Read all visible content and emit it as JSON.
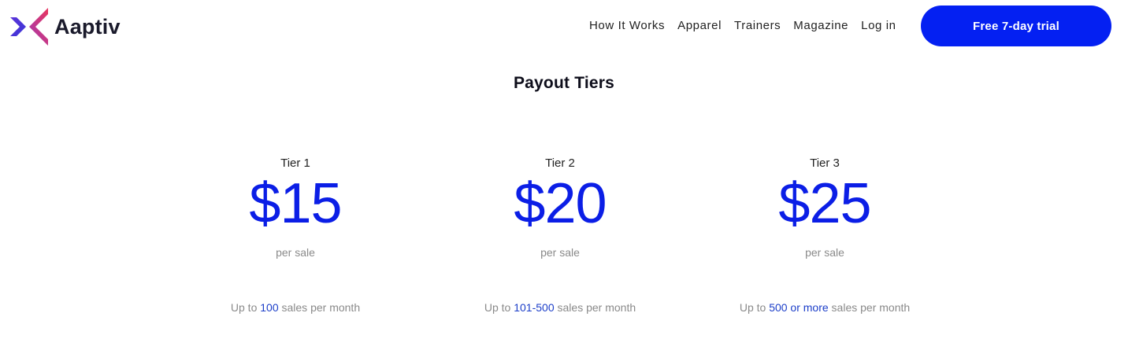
{
  "brand": {
    "name": "Aaptiv",
    "colors": {
      "mark_left": "#3b35d6",
      "mark_right": "#e8355f",
      "accent": "#0420f2",
      "price": "#0b1ee6"
    }
  },
  "nav": {
    "items": [
      {
        "label": "How It Works"
      },
      {
        "label": "Apparel"
      },
      {
        "label": "Trainers"
      },
      {
        "label": "Magazine"
      },
      {
        "label": "Log in"
      }
    ],
    "cta_label": "Free 7-day trial"
  },
  "section": {
    "title": "Payout Tiers"
  },
  "tiers": [
    {
      "label": "Tier 1",
      "price": "$15",
      "unit": "per sale",
      "desc_prefix": "Up to ",
      "desc_highlight": "100",
      "desc_suffix": " sales per month"
    },
    {
      "label": "Tier 2",
      "price": "$20",
      "unit": "per sale",
      "desc_prefix": "Up to ",
      "desc_highlight": "101-500",
      "desc_suffix": " sales per month"
    },
    {
      "label": "Tier 3",
      "price": "$25",
      "unit": "per sale",
      "desc_prefix": "Up to ",
      "desc_highlight": "500 or more",
      "desc_suffix": " sales per month"
    }
  ]
}
